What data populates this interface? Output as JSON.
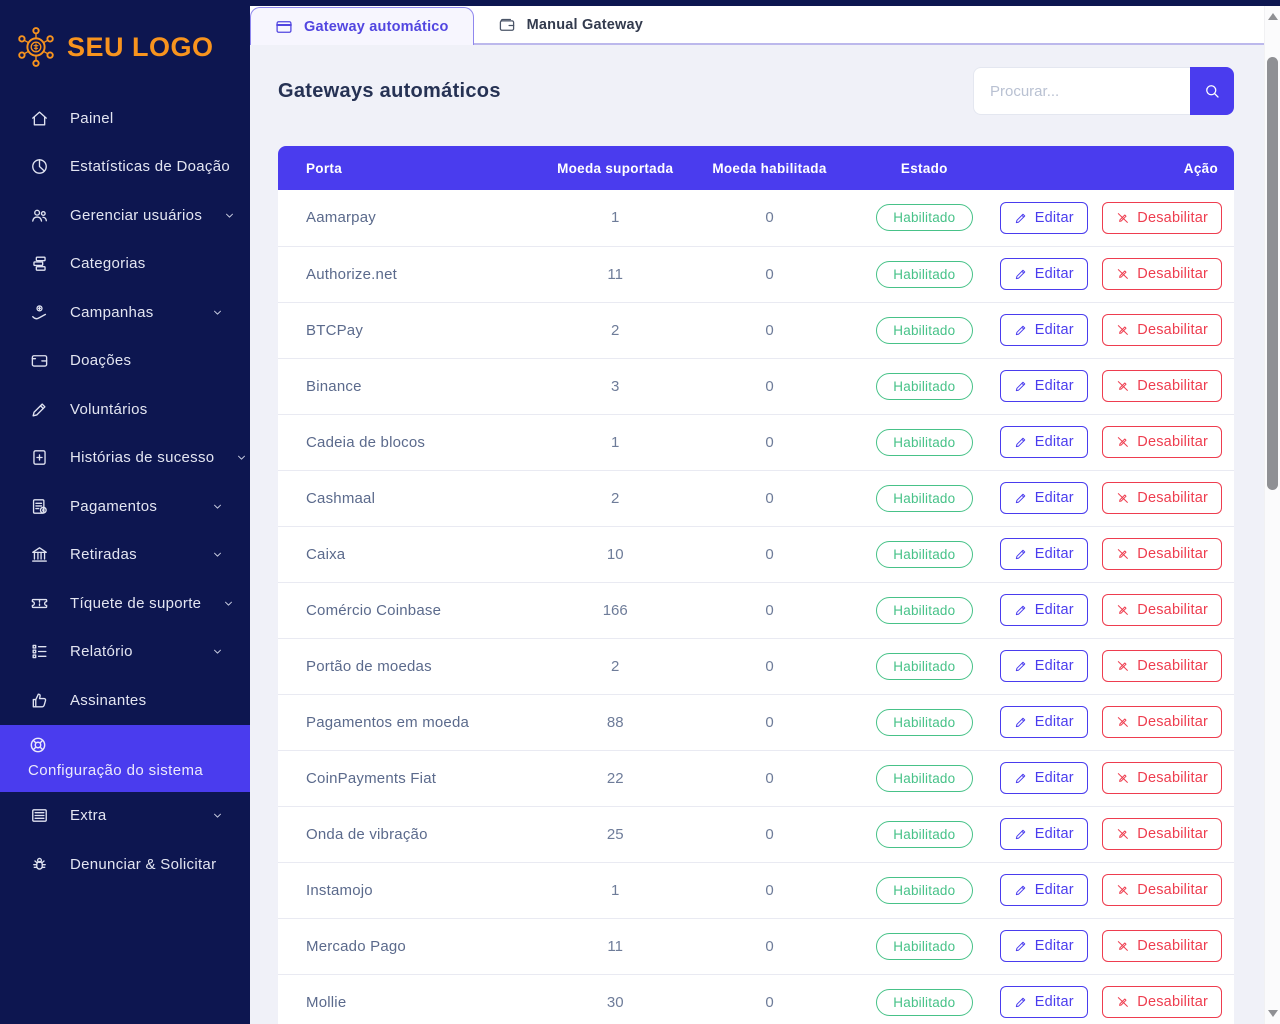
{
  "app": {
    "logo_text": "SEU LOGO",
    "logo_icon": "network-logo-icon"
  },
  "colors": {
    "sidebar_navy": "#0d1650",
    "accent_purple": "#4a3cee",
    "tab_text_purple": "#5246e0",
    "status_green": "#47c288",
    "danger_red": "#ee3d4f",
    "logo_orange": "#f8941e",
    "content_bg": "#f0f1f8"
  },
  "sidebar": {
    "items": [
      {
        "label": "Painel",
        "icon": "home-icon",
        "chevron": false,
        "active": false
      },
      {
        "label": "Estatísticas de Doação",
        "icon": "pie-chart-icon",
        "chevron": false,
        "active": false
      },
      {
        "label": "Gerenciar usuários",
        "icon": "users-icon",
        "chevron": true,
        "active": false
      },
      {
        "label": "Categorias",
        "icon": "categories-icon",
        "chevron": false,
        "active": false
      },
      {
        "label": "Campanhas",
        "icon": "donate-hand-icon",
        "chevron": true,
        "active": false
      },
      {
        "label": "Doações",
        "icon": "wallet-icon",
        "chevron": false,
        "active": false
      },
      {
        "label": "Voluntários",
        "icon": "volunteer-pen-icon",
        "chevron": false,
        "active": false
      },
      {
        "label": "Histórias de sucesso",
        "icon": "document-plus-icon",
        "chevron": true,
        "active": false
      },
      {
        "label": "Pagamentos",
        "icon": "invoice-dollar-icon",
        "chevron": true,
        "active": false
      },
      {
        "label": "Retiradas",
        "icon": "bank-icon",
        "chevron": true,
        "active": false
      },
      {
        "label": "Tíquete de suporte",
        "icon": "ticket-icon",
        "chevron": true,
        "active": false
      },
      {
        "label": "Relatório",
        "icon": "report-list-icon",
        "chevron": true,
        "active": false
      },
      {
        "label": "Assinantes",
        "icon": "thumbs-up-icon",
        "chevron": false,
        "active": false
      },
      {
        "label": "Configuração do sistema",
        "icon": "gear-icon",
        "chevron": false,
        "active": true
      },
      {
        "label": "Extra",
        "icon": "extra-menu-icon",
        "chevron": true,
        "active": false
      },
      {
        "label": "Denunciar & Solicitar",
        "icon": "bug-icon",
        "chevron": false,
        "active": false
      }
    ]
  },
  "tabs": [
    {
      "label": "Gateway automático",
      "icon": "credit-card-icon",
      "active": true
    },
    {
      "label": "Manual Gateway",
      "icon": "wallet2-icon",
      "active": false
    }
  ],
  "page": {
    "title": "Gateways automáticos"
  },
  "search": {
    "placeholder": "Procurar...",
    "button_icon": "search-icon"
  },
  "table": {
    "columns": [
      "Porta",
      "Moeda suportada",
      "Moeda habilitada",
      "Estado",
      "Ação"
    ],
    "status_label": "Habilitado",
    "edit_label": "Editar",
    "disable_label": "Desabilitar",
    "rows": [
      {
        "name": "Aamarpay",
        "supported": 1,
        "enabled": 0,
        "status": "Habilitado"
      },
      {
        "name": "Authorize.net",
        "supported": 11,
        "enabled": 0,
        "status": "Habilitado"
      },
      {
        "name": "BTCPay",
        "supported": 2,
        "enabled": 0,
        "status": "Habilitado"
      },
      {
        "name": "Binance",
        "supported": 3,
        "enabled": 0,
        "status": "Habilitado"
      },
      {
        "name": "Cadeia de blocos",
        "supported": 1,
        "enabled": 0,
        "status": "Habilitado"
      },
      {
        "name": "Cashmaal",
        "supported": 2,
        "enabled": 0,
        "status": "Habilitado"
      },
      {
        "name": "Caixa",
        "supported": 10,
        "enabled": 0,
        "status": "Habilitado"
      },
      {
        "name": "Comércio Coinbase",
        "supported": 166,
        "enabled": 0,
        "status": "Habilitado"
      },
      {
        "name": "Portão de moedas",
        "supported": 2,
        "enabled": 0,
        "status": "Habilitado"
      },
      {
        "name": "Pagamentos em moeda",
        "supported": 88,
        "enabled": 0,
        "status": "Habilitado"
      },
      {
        "name": "CoinPayments Fiat",
        "supported": 22,
        "enabled": 0,
        "status": "Habilitado"
      },
      {
        "name": "Onda de vibração",
        "supported": 25,
        "enabled": 0,
        "status": "Habilitado"
      },
      {
        "name": "Instamojo",
        "supported": 1,
        "enabled": 0,
        "status": "Habilitado"
      },
      {
        "name": "Mercado Pago",
        "supported": 11,
        "enabled": 0,
        "status": "Habilitado"
      },
      {
        "name": "Mollie",
        "supported": 30,
        "enabled": 0,
        "status": "Habilitado"
      }
    ]
  }
}
